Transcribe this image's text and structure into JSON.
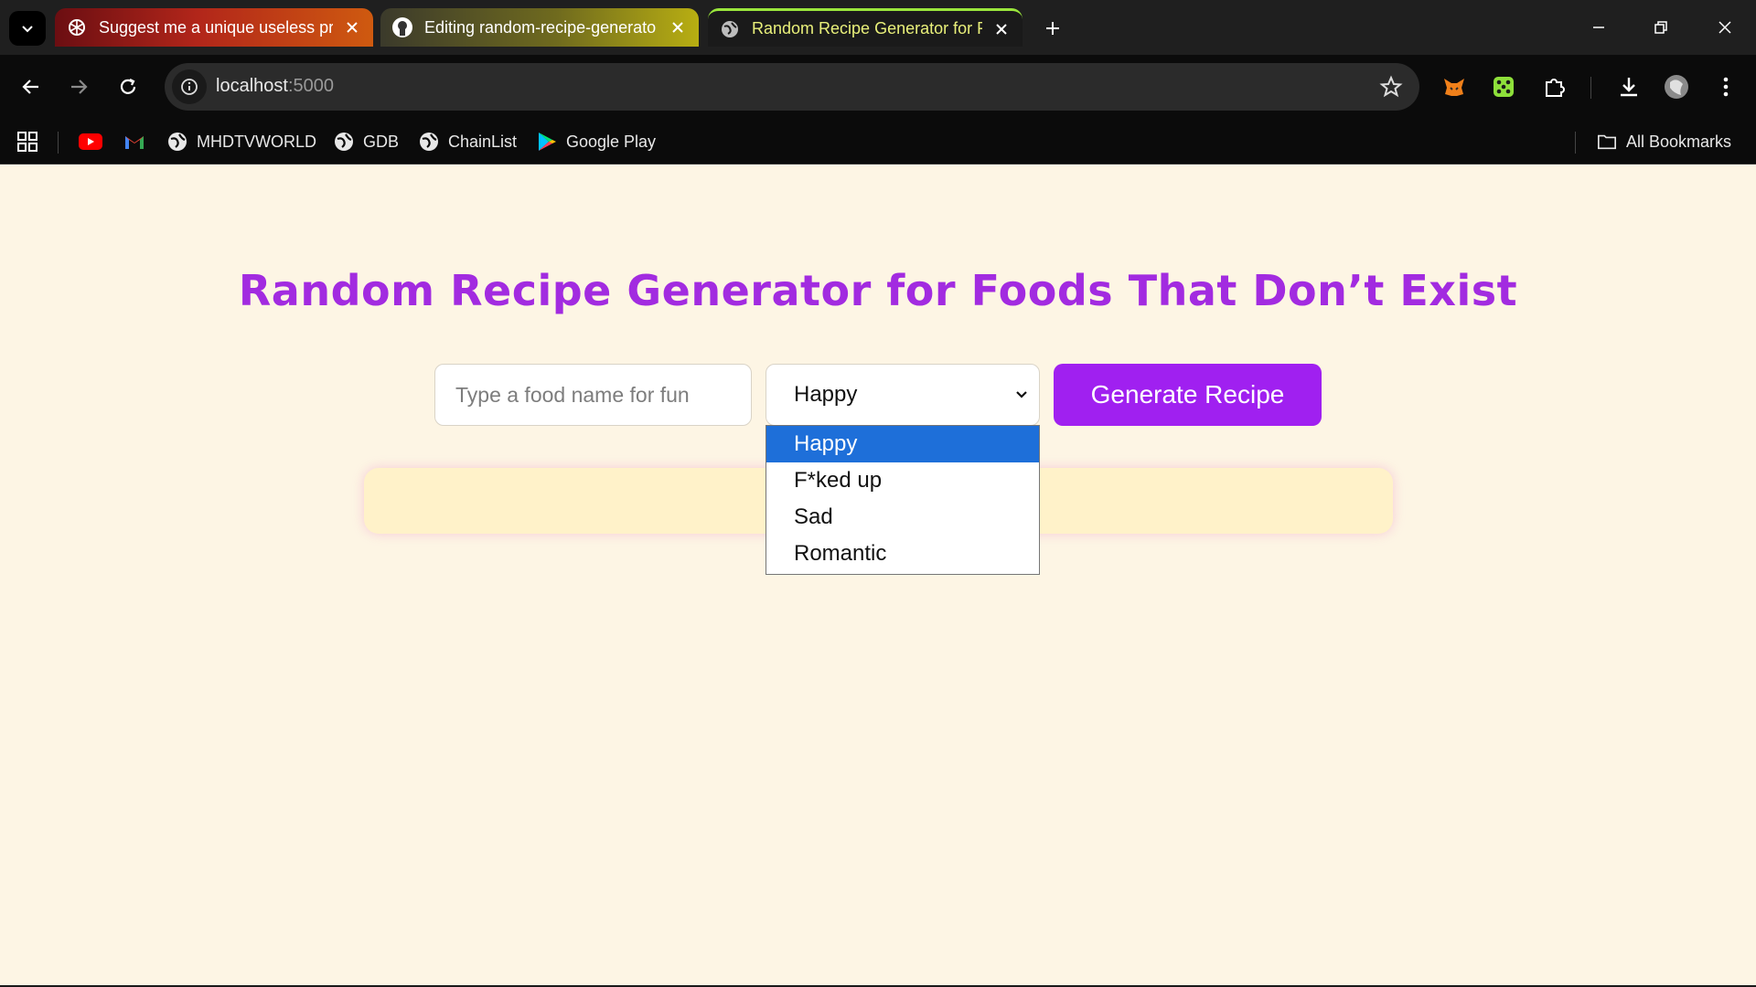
{
  "browser": {
    "tabs": [
      {
        "title": "Suggest me a unique useless pr",
        "favicon": "openai-icon"
      },
      {
        "title": "Editing random-recipe-generato",
        "favicon": "github-icon"
      },
      {
        "title": "Random Recipe Generator for F",
        "favicon": "globe-icon"
      }
    ],
    "active_tab_index": 2,
    "url_host": "localhost",
    "url_port": ":5000",
    "bookmarks": [
      "MHDTVWORLD",
      "GDB",
      "ChainList",
      "Google Play"
    ],
    "all_bookmarks_label": "All Bookmarks",
    "colors": {
      "active_tab_text": "#e9f07a",
      "active_tab_accent": "#9ae63c"
    }
  },
  "page": {
    "title": "Random Recipe Generator for Foods That Don’t Exist",
    "food_input_placeholder": "Type a food name for fun",
    "food_input_value": "",
    "mood_selected": "Happy",
    "mood_options": [
      "Happy",
      "F*ked up",
      "Sad",
      "Romantic"
    ],
    "generate_label": "Generate Recipe",
    "result_text": "",
    "colors": {
      "title": "#a22be0",
      "button": "#a020f0",
      "background": "#fdf5e4",
      "result_bg": "#fff2c9",
      "option_highlight": "#1e6fd9"
    }
  }
}
